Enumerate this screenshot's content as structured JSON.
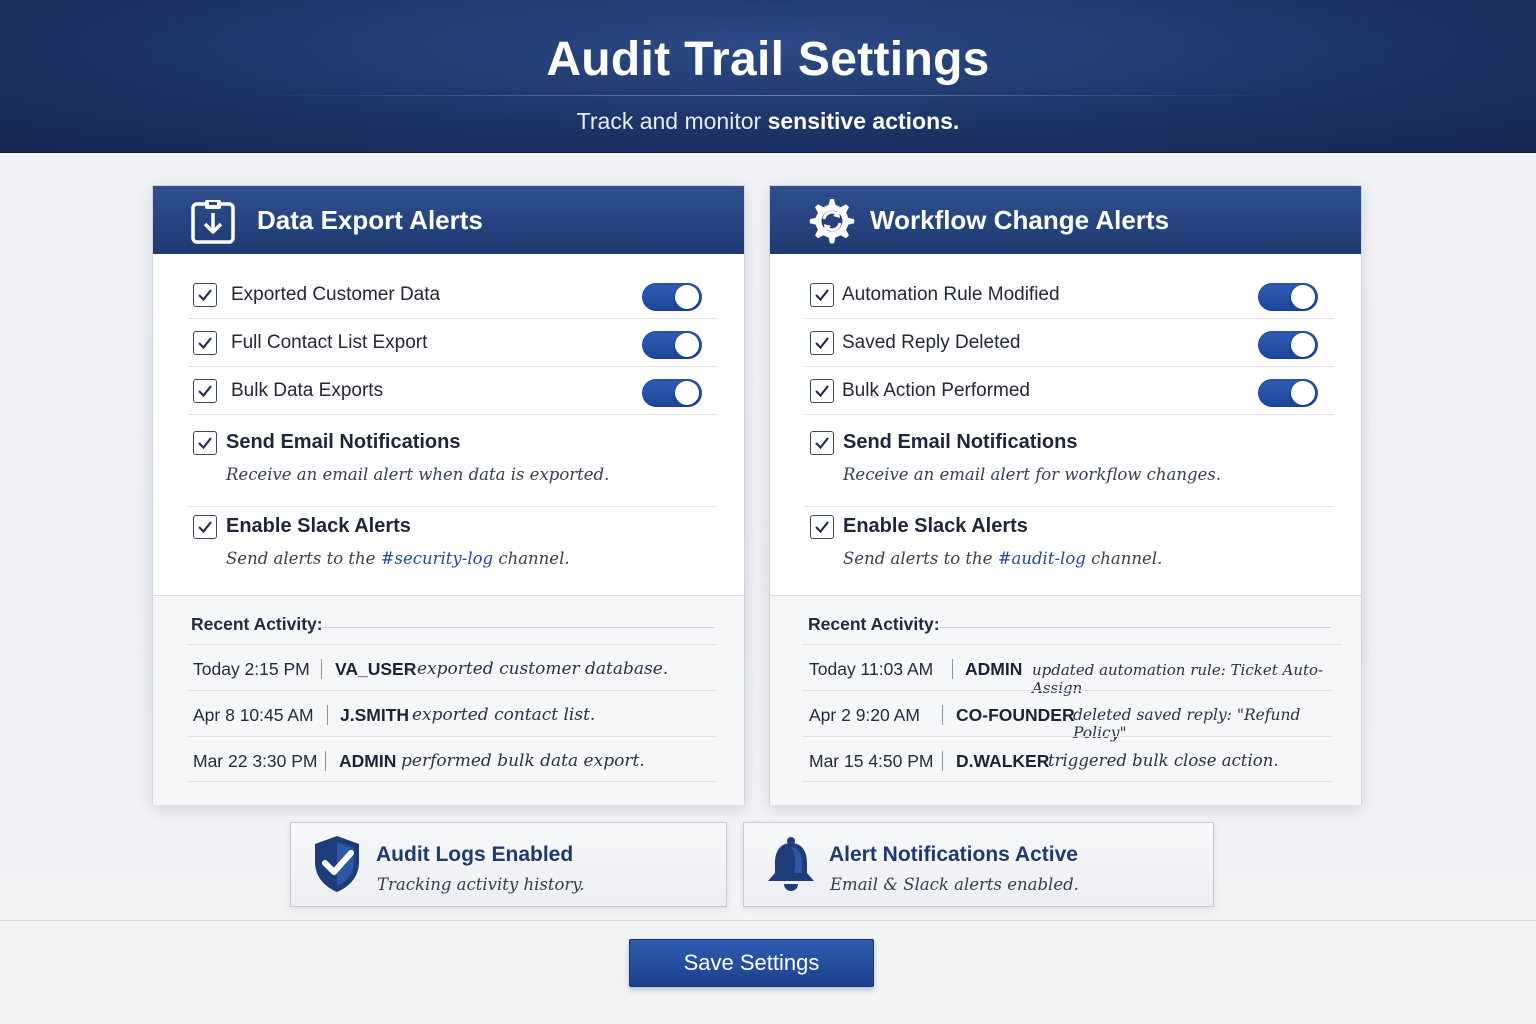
{
  "header": {
    "title": "Audit Trail Settings",
    "subtitle_prefix": "Track and monitor",
    "subtitle_emphasis": "sensitive actions."
  },
  "panels": [
    {
      "title": "Data Export Alerts",
      "icon": "clipboard-download-icon",
      "toggle_rows": [
        {
          "label": "Exported Customer Data",
          "checked": true,
          "enabled": true
        },
        {
          "label": "Full Contact List Export",
          "checked": true,
          "enabled": true
        },
        {
          "label": "Bulk Data Exports",
          "checked": true,
          "enabled": true
        }
      ],
      "email": {
        "title": "Send Email Notifications",
        "desc": "Receive an email alert when data is exported.",
        "checked": true
      },
      "slack": {
        "title": "Enable Slack Alerts",
        "desc_prefix": "Send alerts to the",
        "channel": "#security-log",
        "desc_suffix": "channel.",
        "checked": true
      },
      "activity_heading": "Recent Activity:",
      "activity": [
        {
          "time": "Today 2:15 PM",
          "user": "VA_USER",
          "action": "exported customer database."
        },
        {
          "time": "Apr 8 10:45 AM",
          "user": "J.SMITH",
          "action": "exported contact list."
        },
        {
          "time": "Mar 22 3:30 PM",
          "user": "ADMIN",
          "action": "performed bulk data export."
        }
      ]
    },
    {
      "title": "Workflow Change Alerts",
      "icon": "gear-sync-icon",
      "toggle_rows": [
        {
          "label": "Automation Rule Modified",
          "checked": true,
          "enabled": true
        },
        {
          "label": "Saved Reply Deleted",
          "checked": true,
          "enabled": true
        },
        {
          "label": "Bulk Action Performed",
          "checked": true,
          "enabled": true
        }
      ],
      "email": {
        "title": "Send Email Notifications",
        "desc": "Receive an email alert for workflow changes.",
        "checked": true
      },
      "slack": {
        "title": "Enable Slack Alerts",
        "desc_prefix": "Send alerts to the",
        "channel": "#audit-log",
        "desc_suffix": "channel.",
        "checked": true
      },
      "activity_heading": "Recent Activity:",
      "activity": [
        {
          "time": "Today 11:03 AM",
          "user": "ADMIN",
          "action": "updated automation rule: Ticket Auto-Assign"
        },
        {
          "time": "Apr 2 9:20 AM",
          "user": "CO-FOUNDER",
          "action": "deleted saved reply: \"Refund Policy\""
        },
        {
          "time": "Mar 15 4:50 PM",
          "user": "D.WALKER",
          "action": "triggered bulk close action."
        }
      ]
    }
  ],
  "status_cards": [
    {
      "title": "Audit Logs Enabled",
      "desc": "Tracking activity history.",
      "icon": "shield-check-icon"
    },
    {
      "title": "Alert Notifications Active",
      "desc": "Email & Slack alerts enabled.",
      "icon": "bell-icon"
    }
  ],
  "save_button": "Save Settings",
  "colors": {
    "header_dark": "#1d3466",
    "accent_blue": "#1e3a73",
    "toggle_on": "#2f5fb8",
    "channel_link": "#1f4aa0"
  }
}
